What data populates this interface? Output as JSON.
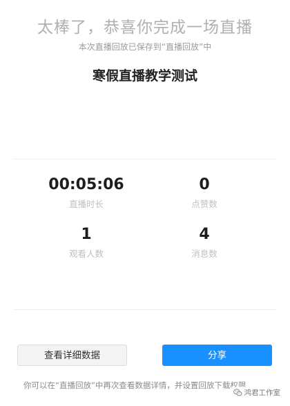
{
  "header": {
    "headline": "太棒了，恭喜你完成一场直播",
    "subline": "本次直播回放已保存到“直播回放”中"
  },
  "session": {
    "title": "寒假直播教学测试"
  },
  "stats": {
    "duration": {
      "value": "00:05:06",
      "label": "直播时长"
    },
    "likes": {
      "value": "0",
      "label": "点赞数"
    },
    "viewers": {
      "value": "1",
      "label": "观看人数"
    },
    "messages": {
      "value": "4",
      "label": "消息数"
    }
  },
  "actions": {
    "details_label": "查看详细数据",
    "share_label": "分享"
  },
  "footer": {
    "note": "你可以在“直播回放”中再次查看数据详情，并设置回放下载权限"
  },
  "watermark": {
    "text": "鸿君工作室",
    "icon": "wechat-icon"
  },
  "colors": {
    "accent": "#1890ff",
    "headline": "#b0b0b0",
    "label": "#c0c0c0"
  }
}
